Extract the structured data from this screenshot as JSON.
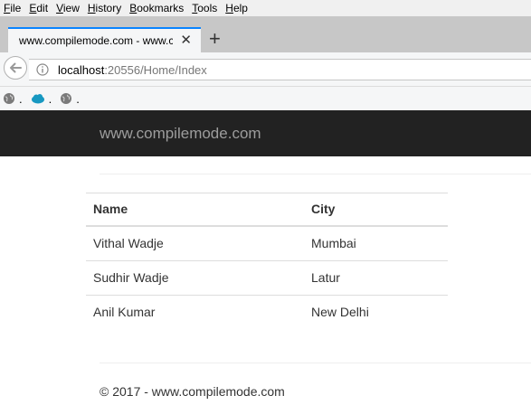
{
  "menu": {
    "items": [
      {
        "first": "F",
        "rest": "ile"
      },
      {
        "first": "E",
        "rest": "dit"
      },
      {
        "first": "V",
        "rest": "iew"
      },
      {
        "first": "H",
        "rest": "istory"
      },
      {
        "first": "B",
        "rest": "ookmarks"
      },
      {
        "first": "T",
        "rest": "ools"
      },
      {
        "first": "H",
        "rest": "elp"
      }
    ]
  },
  "tab": {
    "title": "www.compilemode.com - www.compi",
    "close": "✕",
    "new_tab": "+"
  },
  "urlbar": {
    "host": "localhost",
    "rest": ":20556/Home/Index"
  },
  "bookmarks": {
    "separator": "."
  },
  "header": {
    "brand": "www.compilemode.com"
  },
  "table": {
    "headers": [
      "Name",
      "City"
    ],
    "rows": [
      [
        "Vithal Wadje",
        "Mumbai"
      ],
      [
        "Sudhir Wadje",
        "Latur"
      ],
      [
        "Anil Kumar",
        "New Delhi"
      ]
    ]
  },
  "footer": {
    "text": "© 2017 - www.compilemode.com"
  },
  "colors": {
    "header_bg": "#222222",
    "brand_text": "#9d9d9d",
    "tab_accent": "#0a84ff"
  }
}
